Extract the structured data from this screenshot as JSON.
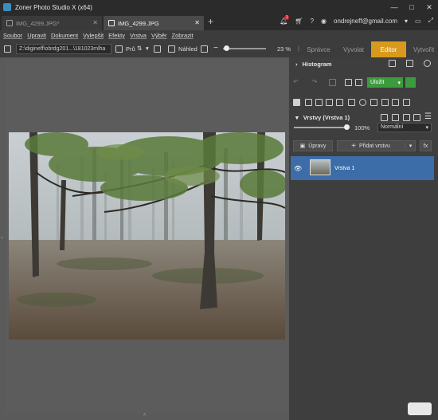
{
  "window": {
    "title": "Zoner Photo Studio X (x64)",
    "controls": [
      "—",
      "□",
      "✕"
    ]
  },
  "tabs": [
    {
      "label": "IMG_4299.JPG*",
      "active": false
    },
    {
      "label": "IMG_4299.JPG",
      "active": true
    }
  ],
  "account": {
    "email": "ondrejneff@gmail.com",
    "notifications": "1"
  },
  "menu": [
    "Soubor",
    "Upravit",
    "Dokument",
    "Vylepšit",
    "Efekty",
    "Vrstva",
    "Výběr",
    "Zobrazit"
  ],
  "toolbar": {
    "path": "Z:\\digineff\\obrdg201...\\181023mlha",
    "sort_label": "Prů",
    "preview_label": "Náhled",
    "zoom": "23 %"
  },
  "modes": [
    {
      "label": "Správce",
      "active": false
    },
    {
      "label": "Vyvolat",
      "active": false
    },
    {
      "label": "Editor",
      "active": true
    },
    {
      "label": "Vytvořit",
      "active": false
    }
  ],
  "panel": {
    "histogram": "Histogram",
    "save_label": "Uložit",
    "layers_header": "Vrstvy (Vrstva 1)",
    "opacity": "100%",
    "blend_mode": "Normální",
    "adjust_label": "Úpravy",
    "add_layer_label": "Přidat vrstvu",
    "fx_label": "fx",
    "layer_name": "Vrstva 1"
  },
  "colors": {
    "accent": "#d89a1c",
    "save": "#3c9b3c",
    "selected_layer": "#3c6da8"
  }
}
